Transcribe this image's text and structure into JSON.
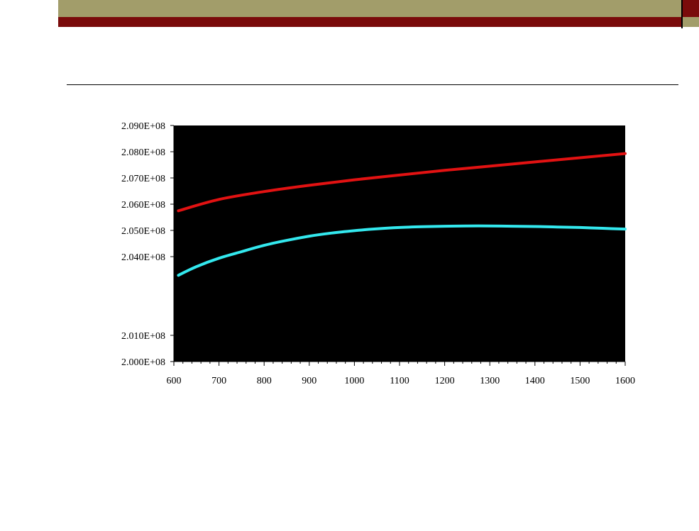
{
  "colors": {
    "olive": "#a29d6a",
    "maroon": "#7a0b0b",
    "plot_background": "#000000",
    "series_red": "#e21212",
    "series_cyan": "#33e8ee"
  },
  "chart_data": {
    "type": "line",
    "title": "",
    "xlabel": "",
    "ylabel": "",
    "xlim": [
      600,
      1600
    ],
    "ylim": [
      200000000,
      209000000
    ],
    "x_ticks": [
      600,
      700,
      800,
      900,
      1000,
      1100,
      1200,
      1300,
      1400,
      1500,
      1600
    ],
    "x_tick_labels": [
      "600",
      "700",
      "800",
      "900",
      "1000",
      "1100",
      "1200",
      "1300",
      "1400",
      "1500",
      "1600"
    ],
    "y_ticks": [
      200000000,
      201000000,
      204000000,
      205000000,
      206000000,
      207000000,
      208000000,
      209000000
    ],
    "y_tick_labels": [
      "2.000E+08",
      "2.010E+08",
      "2.040E+08",
      "2.050E+08",
      "2.060E+08",
      "2.070E+08",
      "2.080E+08",
      "2.090E+08"
    ],
    "grid": false,
    "legend": "none",
    "series": [
      {
        "color": "#e21212",
        "x": [
          610,
          700,
          800,
          900,
          1000,
          1100,
          1200,
          1300,
          1400,
          1500,
          1600
        ],
        "y": [
          205750000,
          206180000,
          206480000,
          206720000,
          206930000,
          207110000,
          207290000,
          207450000,
          207610000,
          207770000,
          207930000
        ]
      },
      {
        "color": "#33e8ee",
        "x": [
          610,
          650,
          700,
          750,
          800,
          850,
          900,
          950,
          1000,
          1050,
          1100,
          1150,
          1200,
          1250,
          1300,
          1350,
          1400,
          1450,
          1500,
          1550,
          1600
        ],
        "y": [
          203290000,
          203620000,
          203940000,
          204190000,
          204430000,
          204620000,
          204780000,
          204900000,
          204990000,
          205060000,
          205110000,
          205140000,
          205160000,
          205170000,
          205170000,
          205160000,
          205150000,
          205130000,
          205110000,
          205080000,
          205050000
        ]
      }
    ]
  }
}
